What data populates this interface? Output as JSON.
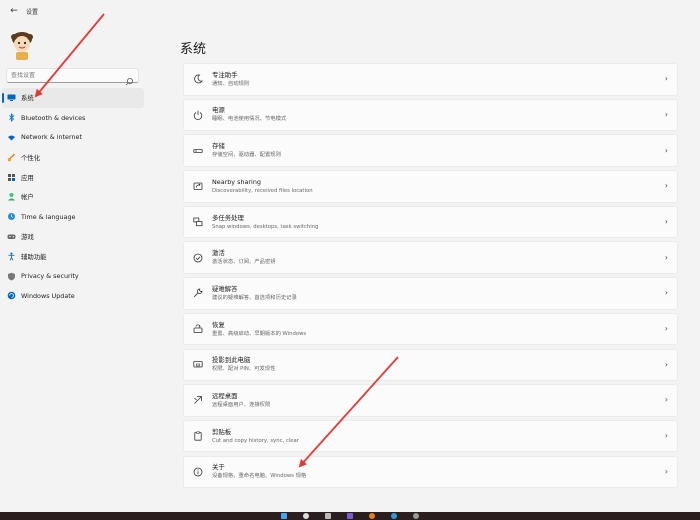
{
  "window": {
    "title": "设置",
    "back_glyph": "←"
  },
  "search": {
    "placeholder": "查找设置"
  },
  "sidebar": {
    "items": [
      {
        "label": "系统",
        "icon": "monitor-icon",
        "active": true
      },
      {
        "label": "Bluetooth & devices",
        "icon": "bluetooth-icon"
      },
      {
        "label": "Network & internet",
        "icon": "wifi-icon"
      },
      {
        "label": "个性化",
        "icon": "brush-icon"
      },
      {
        "label": "应用",
        "icon": "apps-icon"
      },
      {
        "label": "帐户",
        "icon": "person-icon"
      },
      {
        "label": "Time & language",
        "icon": "globe-clock-icon"
      },
      {
        "label": "游戏",
        "icon": "gamepad-icon"
      },
      {
        "label": "辅助功能",
        "icon": "accessibility-icon"
      },
      {
        "label": "Privacy & security",
        "icon": "shield-icon"
      },
      {
        "label": "Windows Update",
        "icon": "update-icon"
      }
    ]
  },
  "main": {
    "title": "系统",
    "cards": [
      {
        "title": "专注助手",
        "subtitle": "通知、自动规则",
        "icon": "moon-icon"
      },
      {
        "title": "电源",
        "subtitle": "睡眠、电池使用情况、节电模式",
        "icon": "power-icon"
      },
      {
        "title": "存储",
        "subtitle": "存储空间、驱动器、配置规则",
        "icon": "storage-icon"
      },
      {
        "title": "Nearby sharing",
        "subtitle": "Discoverability, received files location",
        "icon": "share-icon"
      },
      {
        "title": "多任务处理",
        "subtitle": "Snap windows, desktops, task switching",
        "icon": "multitask-icon"
      },
      {
        "title": "激活",
        "subtitle": "激活状态、订阅、产品密钥",
        "icon": "check-circle-icon"
      },
      {
        "title": "疑难解答",
        "subtitle": "建议的疑难解答、首选项和历史记录",
        "icon": "wrench-icon"
      },
      {
        "title": "恢复",
        "subtitle": "重置、高级启动、早期版本的 Windows",
        "icon": "recovery-icon"
      },
      {
        "title": "投影到此电脑",
        "subtitle": "权限、配对 PIN、可发现性",
        "icon": "project-icon"
      },
      {
        "title": "远程桌面",
        "subtitle": "远程桌面用户、连接权限",
        "icon": "remote-desktop-icon"
      },
      {
        "title": "剪贴板",
        "subtitle": "Cut and copy history, sync, clear",
        "icon": "clipboard-icon"
      },
      {
        "title": "关于",
        "subtitle": "设备规格，重命名电脑、Windows 规格",
        "icon": "info-icon"
      }
    ],
    "chevron": "›"
  },
  "colors": {
    "accent": "#0067c0",
    "arrow": "#e53935",
    "taskbar": "#2a1f1e"
  }
}
